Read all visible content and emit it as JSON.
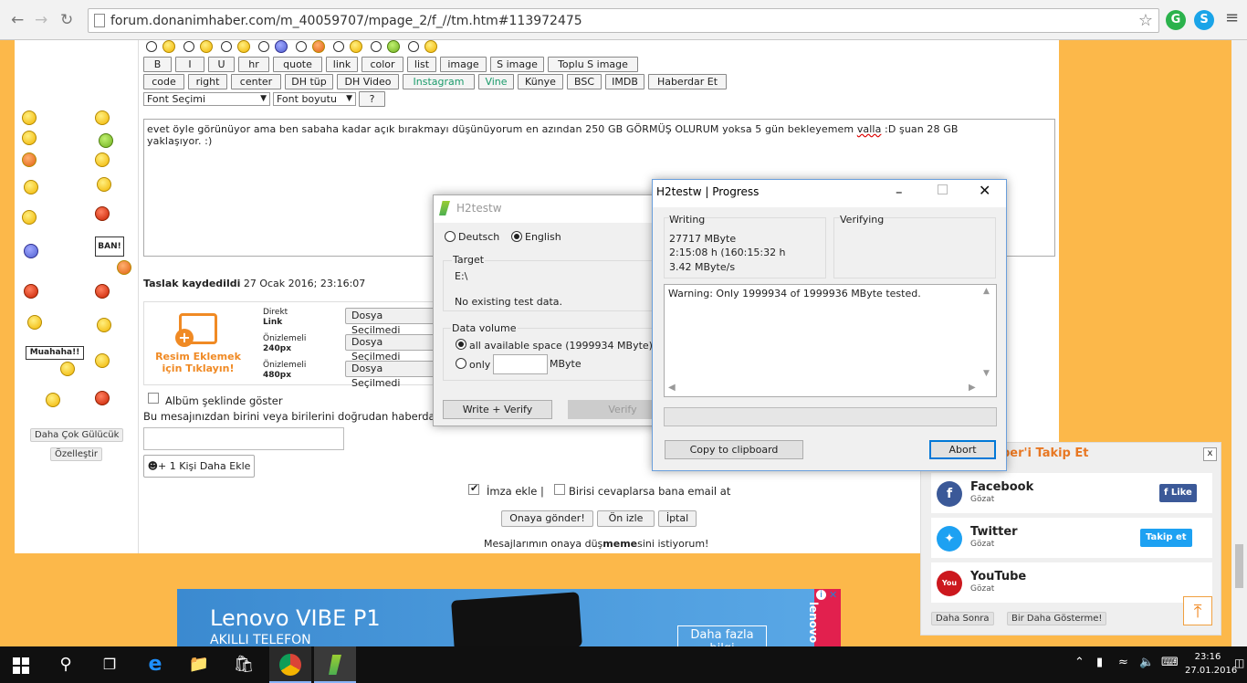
{
  "browser": {
    "url": "forum.donanimhaber.com/m_40059707/mpage_2/f_//tm.htm#113972475"
  },
  "left_sidebar": {
    "more_smileys": "Daha Çok Gülücük",
    "customize": "Özelleştir",
    "ban_label": "BAN!",
    "muahaha_label": "Muahaha!!"
  },
  "editor": {
    "row1": [
      "B",
      "I",
      "U",
      "hr",
      "quote",
      "link",
      "color",
      "list",
      "image",
      "S image",
      "Toplu S image"
    ],
    "row2": [
      "code",
      "right",
      "center",
      "DH tüp",
      "DH Video",
      "Instagram",
      "Vine",
      "Künye",
      "BSC",
      "IMDB",
      "Haberdar Et"
    ],
    "font_select": "Font Seçimi",
    "font_size": "Font boyutu",
    "help": "?",
    "message": "evet  öyle görünüyor ama ben sabaha kadar açık bırakmayı düşünüyorum en azından 250 GB GÖRMÜŞ OLURUM yoksa  5 gün bekleyemem ",
    "message_misspelled": "valla",
    "message_rest": " :D  şuan  28 GB",
    "message_line2": "yaklaşıyor. :)"
  },
  "draft": {
    "label": "Taslak kaydedildi",
    "time": "27 Ocak 2016; 23:16:07"
  },
  "upload": {
    "add_image": "Resim Eklemek",
    "click": "için Tıklayın!",
    "options": [
      {
        "line1": "Direkt",
        "line2": "Link",
        "button": "Dosya Seçilmedi"
      },
      {
        "line1": "Önizlemeli",
        "line2": "240px",
        "button": "Dosya Seçilmedi"
      },
      {
        "line1": "Önizlemeli",
        "line2": "480px",
        "button": "Dosya Seçilmedi"
      }
    ]
  },
  "options": {
    "album": "Albüm şeklinde göster",
    "notify_text": "Bu mesajınızdan birini veya birilerini doğrudan haberda",
    "add_person": "1 Kişi Daha Ekle",
    "signature": "İmza ekle |",
    "email_notify": "Birisi cevaplarsa bana email at",
    "submit": "Onaya gönder!",
    "preview": "Ön izle",
    "cancel": "İptal",
    "footer_pre": "Mesajlarımın onaya düş",
    "footer_bold": "meme",
    "footer_post": "sini istiyorum!"
  },
  "h2testw_main": {
    "title": "H2testw",
    "lang_de": "Deutsch",
    "lang_en": "English",
    "target_label": "Target",
    "target_path": "E:\\",
    "target_status": "No existing test data.",
    "volume_label": "Data volume",
    "all_space": "all available space (1999934 MByte)",
    "only": "only",
    "mbyte": "MByte",
    "write_verify": "Write + Verify",
    "verify": "Verify"
  },
  "h2testw_progress": {
    "title": "H2testw | Progress",
    "writing_label": "Writing",
    "written": "27717 MByte",
    "elapsed": "2:15:08 h (160:15:32 h",
    "speed": "3.42 MByte/s",
    "verifying_label": "Verifying",
    "warning": "Warning: Only 1999934 of 1999936 MByte tested.",
    "copy": "Copy to clipboard",
    "abort": "Abort"
  },
  "follow_popup": {
    "title": "ber'i Takip Et",
    "close": "x",
    "items": [
      {
        "name": "Facebook",
        "sub": "Gözat",
        "btn": "Like",
        "color": "#3b5998"
      },
      {
        "name": "Twitter",
        "sub": "Gözat",
        "btn": "Takip et",
        "color": "#1da1f2"
      },
      {
        "name": "YouTube",
        "sub": "Gözat",
        "btn": "",
        "color": "#cc181e"
      }
    ],
    "later": "Daha Sonra",
    "never": "Bir Daha Gösterme!"
  },
  "ad": {
    "brand": "Lenovo VIBE P1",
    "sub": "AKILLI TELEFON",
    "cta": "Daha fazla",
    "cta2": "bilgi",
    "side": "lenovo"
  },
  "taskbar": {
    "time": "23:16",
    "date": "27.01.2016"
  }
}
